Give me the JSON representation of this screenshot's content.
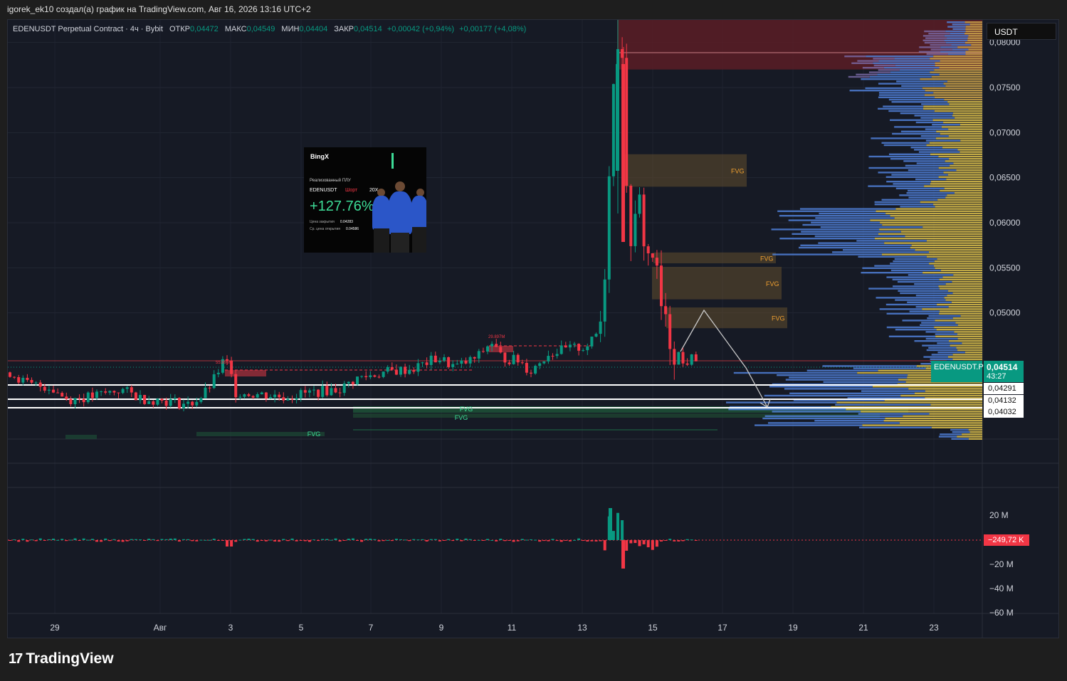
{
  "header": {
    "attribution": "igorek_ek10 создал(а) график на TradingView.com, Авг 16, 2026 13:16 UTC+2"
  },
  "legend": {
    "symbol": "EDENUSDT Perpetual Contract · 4ч · Bybit",
    "open_label": "ОТКР",
    "open": "0,04472",
    "high_label": "МАКС",
    "high": "0,04549",
    "low_label": "МИН",
    "low": "0,04404",
    "close_label": "ЗАКР",
    "close": "0,04514",
    "change": "+0,00042 (+0,94%)",
    "change2": "+0,00177 (+4,08%)"
  },
  "price_scale": {
    "unit": "USDT",
    "ticks": [
      "0,08000",
      "0,07500",
      "0,07000",
      "0,06500",
      "0,06000",
      "0,05500",
      "0,05000"
    ],
    "current_symbol": "EDENUSDT.P",
    "current_price": "0,04514",
    "countdown": "43:27",
    "levels": [
      "0,04291",
      "0,04132",
      "0,04032"
    ]
  },
  "volume_scale": {
    "ticks": [
      "20 M",
      "−20 M",
      "−40 M",
      "−60 M"
    ],
    "current": "−249,72 K"
  },
  "time_axis": {
    "ticks": [
      "29",
      "Авг",
      "3",
      "5",
      "7",
      "9",
      "11",
      "13",
      "15",
      "17",
      "19",
      "21",
      "23"
    ]
  },
  "annotations": {
    "fvg_bear": [
      "FVG",
      "FVG",
      "FVG",
      "FVG"
    ],
    "fvg_bull": [
      "FVG",
      "FVG",
      "FVG"
    ],
    "vol_label_1": "29.897M",
    "vol_label_2": "55.896M",
    "vol_label_3": "2.13M"
  },
  "promo_card": {
    "brand": "BingX",
    "label": "Реализованный ПЛУ",
    "pair": "EDENUSDT",
    "side": "Шорт",
    "leverage": "20X",
    "pnl": "+127.76%",
    "close_label": "Цена закрытия",
    "close_price": "0.04283",
    "entry_label": "Ср. цена открытия",
    "entry_price": "0.04586"
  },
  "footer": {
    "brand": "TradingView"
  },
  "colors": {
    "up": "#089981",
    "down": "#f23645",
    "background": "#161a25",
    "profile_blue": "#4f7fd6",
    "profile_yellow": "#d4b94a"
  },
  "chart_data": {
    "type": "candlestick",
    "title": "",
    "x_range": [
      "Jul 27",
      "Aug 24"
    ],
    "y_range": [
      0.036,
      0.0825
    ],
    "price_zones": {
      "resistance_high": [
        0.077,
        0.085
      ],
      "fvg_bear": [
        [
          0.064,
          0.0676
        ],
        [
          0.0555,
          0.0567
        ],
        [
          0.0515,
          0.0551
        ],
        [
          0.0483,
          0.0506
        ]
      ],
      "fvg_bull": [
        [
          0.04,
          0.0407
        ],
        [
          0.0398,
          0.0403
        ]
      ],
      "levels": [
        0.04291,
        0.04132,
        0.04032
      ]
    },
    "current_price": 0.04514,
    "peak_price": 0.082
  }
}
